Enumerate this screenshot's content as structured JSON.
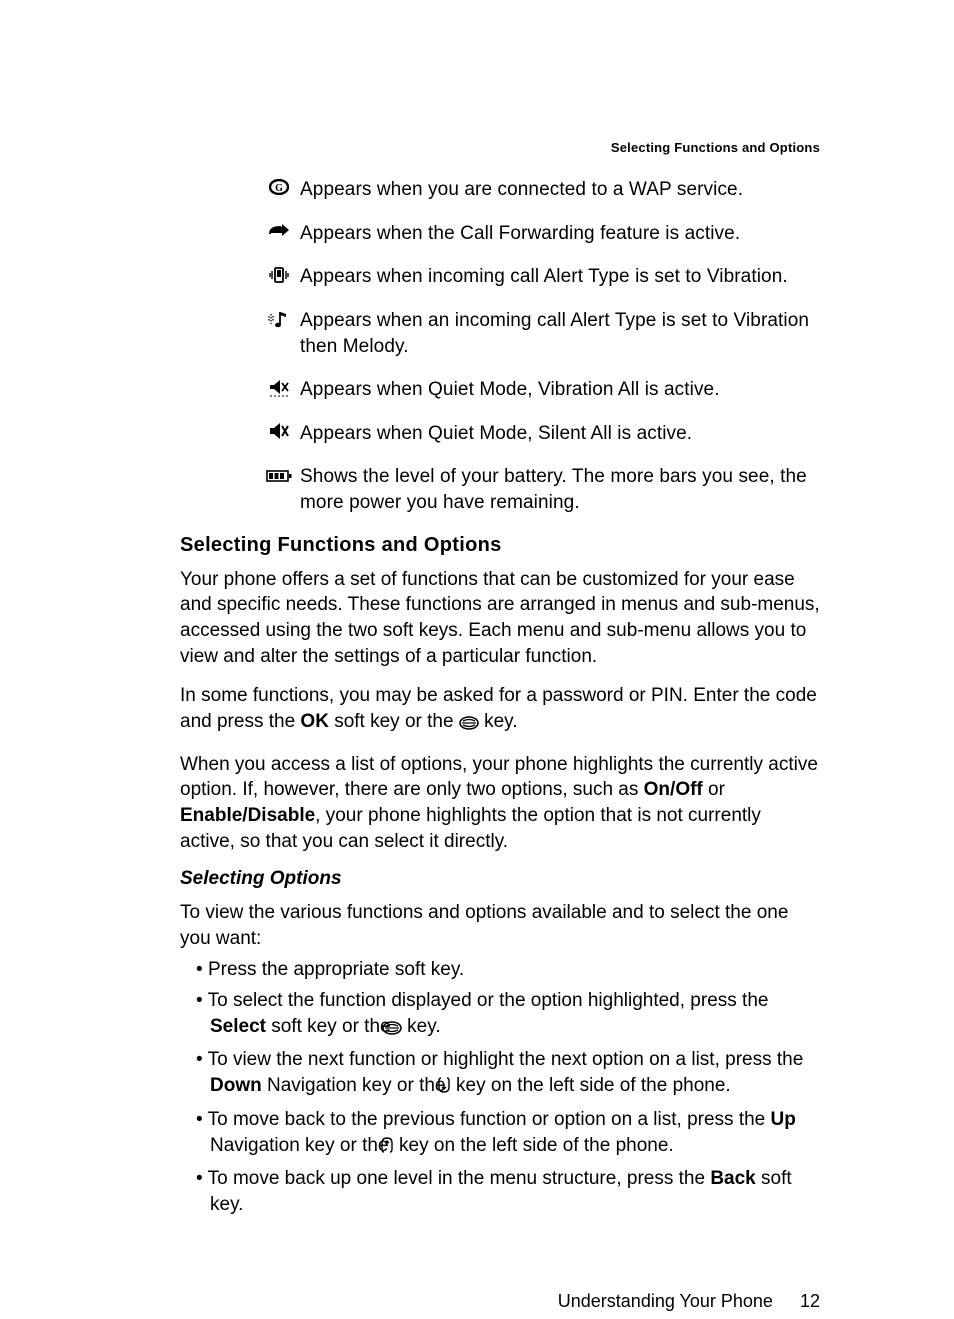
{
  "running_header": "Selecting Functions and Options",
  "icons": [
    {
      "name": "wap-icon",
      "desc": "Appears when you are connected to a WAP service."
    },
    {
      "name": "call-forward-icon",
      "desc": "Appears when the Call Forwarding feature is active."
    },
    {
      "name": "vibration-icon",
      "desc": "Appears when incoming call Alert Type is set to Vibration."
    },
    {
      "name": "vibration-melody-icon",
      "desc": "Appears when an incoming call Alert Type is set to Vibration then Melody."
    },
    {
      "name": "quiet-vibration-icon",
      "desc": "Appears when Quiet Mode, Vibration All is active."
    },
    {
      "name": "quiet-silent-icon",
      "desc": "Appears when Quiet Mode, Silent All is active."
    },
    {
      "name": "battery-icon",
      "desc": "Shows the level of your battery. The more bars you see, the more power you have remaining."
    }
  ],
  "section_heading": "Selecting Functions and Options",
  "para1": "Your phone offers a set of functions that can be customized for your ease and specific needs. These functions are arranged in menus and sub-menus, accessed using the two soft keys. Each menu and sub-menu allows you to view and alter the settings of a particular function.",
  "para2_a": "In some functions, you may be asked for a password or PIN. Enter the code and press the ",
  "para2_ok": "OK",
  "para2_b": " soft key or the ",
  "para2_c": " key.",
  "para3_a": "When you access a list of options, your phone highlights the currently active option. If, however, there are only two options, such as ",
  "para3_onoff": "On/Off",
  "para3_or": " or ",
  "para3_ed": "Enable/Disable",
  "para3_b": ", your phone highlights the option that is not currently active, so that you can select it directly.",
  "sub_heading": "Selecting Options",
  "intro_bullets": "To view the various functions and options available and to select the one you want:",
  "bullets": {
    "b1": "Press the appropriate soft key.",
    "b2_a": "To select the function displayed or the option highlighted, press the ",
    "b2_select": "Select",
    "b2_b": " soft key or the ",
    "b2_c": " key.",
    "b3_a": "To view the next function or highlight the next option on a list, press the ",
    "b3_down": "Down",
    "b3_b": " Navigation key or the ",
    "b3_c": " key on the left side of the phone.",
    "b4_a": "To move back to the previous function or option on a list, press the ",
    "b4_up": "Up",
    "b4_b": " Navigation key or the ",
    "b4_c": " key on the left side of the phone.",
    "b5_a": "To move back up one level in the menu structure, press the ",
    "b5_back": "Back",
    "b5_b": " soft key."
  },
  "footer_section": "Understanding Your Phone",
  "page_number": "12"
}
